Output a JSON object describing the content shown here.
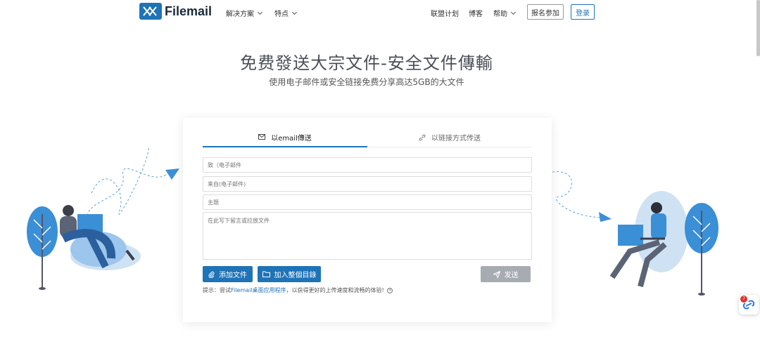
{
  "brand": {
    "name": "Filemail",
    "color": "#1f73b7"
  },
  "nav": {
    "solutions": "解决方案",
    "features": "特点",
    "affiliate": "联盟计划",
    "blog": "博客",
    "help": "帮助",
    "signup": "报名参加",
    "login": "登录"
  },
  "hero": {
    "title": "免费發送大宗文件-安全文件傳輸",
    "subtitle": "使用电子邮件或安全链接免费分享高达5GB的大文件"
  },
  "tabs": {
    "email": "以email傳送",
    "link": "以链接方式传送"
  },
  "form": {
    "to_placeholder": "致（电子邮件",
    "from_placeholder": "来自(电子邮件)",
    "subject_placeholder": "主题",
    "message_placeholder": "在此写下留言或拉放文件"
  },
  "buttons": {
    "add_files": "添加文件",
    "add_folder": "加入整個目錄",
    "send": "发送"
  },
  "tip": {
    "prefix": "提示：尝试",
    "link": "Filemail桌面应用程序",
    "suffix": "，以获得更好的上传速度和流畅的体验!",
    "close": "×"
  },
  "widget": {
    "badge": "7"
  },
  "icons": {
    "logo": "filemail-logo-icon",
    "mail": "mail-icon",
    "link": "link-icon",
    "paperclip": "paperclip-icon",
    "folder": "folder-icon",
    "send": "paper-plane-icon"
  }
}
